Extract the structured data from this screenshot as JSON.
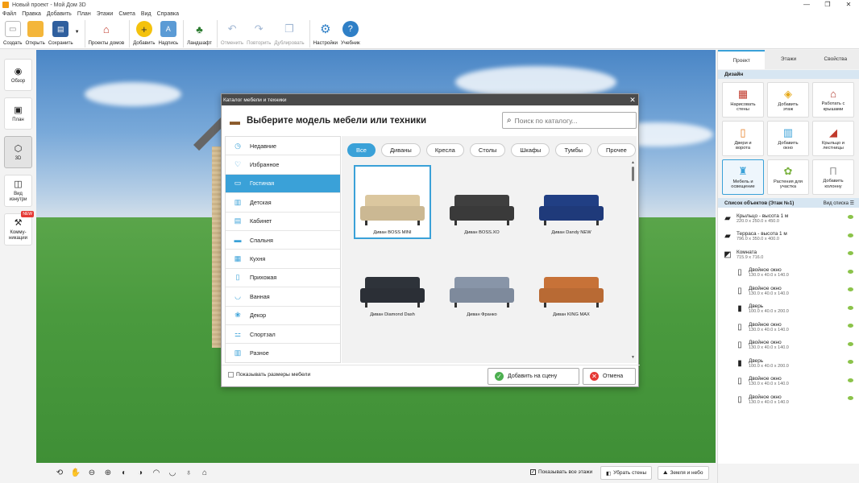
{
  "window": {
    "title": "Новый проект - Мой Дом 3D",
    "minimize": "—",
    "maximize": "❐",
    "close": "✕"
  },
  "menu": [
    "Файл",
    "Правка",
    "Добавить",
    "План",
    "Этажи",
    "Смета",
    "Вид",
    "Справка"
  ],
  "toolbar": [
    {
      "label": "Создать",
      "icon": "new-file-icon"
    },
    {
      "label": "Открыть",
      "icon": "folder-icon"
    },
    {
      "label": "Сохранить",
      "icon": "save-icon"
    },
    {
      "label": "Проекты домов",
      "icon": "house-icon"
    },
    {
      "label": "Добавить",
      "icon": "add-icon"
    },
    {
      "label": "Надпись",
      "icon": "label-icon"
    },
    {
      "label": "Ландшафт",
      "icon": "tree-icon"
    },
    {
      "label": "Отменить",
      "icon": "undo-icon"
    },
    {
      "label": "Повторить",
      "icon": "redo-icon"
    },
    {
      "label": "Дублировать",
      "icon": "duplicate-icon"
    },
    {
      "label": "Настройки",
      "icon": "gear-icon"
    },
    {
      "label": "Учебник",
      "icon": "help-icon"
    }
  ],
  "leftbar": [
    {
      "label": "Обзор",
      "icon": "eye-icon"
    },
    {
      "label": "План",
      "icon": "plan-icon"
    },
    {
      "label": "3D",
      "icon": "cube-icon"
    },
    {
      "label": "Вид изнутри",
      "icon": "interior-icon"
    },
    {
      "label": "Комму- никации",
      "icon": "communications-icon",
      "badge": "NEW"
    }
  ],
  "bottom": {
    "show_all_floors": "Показывать все этажи",
    "remove_walls": "Убрать стены",
    "earth_sky": "Земля и небо"
  },
  "rightpanel": {
    "tabs": [
      "Проект",
      "Этажи",
      "Свойства"
    ],
    "design_title": "Дизайн",
    "design_buttons": [
      {
        "label": "Нарисовать стены",
        "icon": "brick-wall-icon"
      },
      {
        "label": "Добавить этаж",
        "icon": "add-floor-icon"
      },
      {
        "label": "Работать с крышами",
        "icon": "roof-icon"
      },
      {
        "label": "Двери и ворота",
        "icon": "door-icon"
      },
      {
        "label": "Добавить окно",
        "icon": "window-icon"
      },
      {
        "label": "Крыльцо и лестницы",
        "icon": "stairs-icon"
      },
      {
        "label": "Мебель и освещение",
        "icon": "chair-icon"
      },
      {
        "label": "Растения для участка",
        "icon": "plant-icon"
      },
      {
        "label": "Добавить колонну",
        "icon": "column-icon"
      }
    ],
    "list_title": "Список объектов (Этаж №1)",
    "list_view": "Вид списка",
    "objects": [
      {
        "name": "Крыльцо - высота 1 м",
        "dims": "220.0 x 250.0 x 450.0",
        "sub": false,
        "icon": "porch-icon"
      },
      {
        "name": "Терраса - высота 1 м",
        "dims": "796.0 x 350.0 x 400.0",
        "sub": false,
        "icon": "terrace-icon"
      },
      {
        "name": "Комната",
        "dims": "715.9 x 716.0",
        "sub": false,
        "icon": "room-icon"
      },
      {
        "name": "Двойное окно",
        "dims": "130.0 x 40.0 x 140.0",
        "sub": true,
        "icon": "window-icon"
      },
      {
        "name": "Двойное окно",
        "dims": "130.0 x 40.0 x 140.0",
        "sub": true,
        "icon": "window-icon"
      },
      {
        "name": "Дверь",
        "dims": "100.0 x 40.0 x 200.0",
        "sub": true,
        "icon": "door-icon"
      },
      {
        "name": "Двойное окно",
        "dims": "130.0 x 40.0 x 140.0",
        "sub": true,
        "icon": "window-icon"
      },
      {
        "name": "Двойное окно",
        "dims": "130.0 x 40.0 x 140.0",
        "sub": true,
        "icon": "window-icon"
      },
      {
        "name": "Дверь",
        "dims": "100.0 x 40.0 x 200.0",
        "sub": true,
        "icon": "door-icon"
      },
      {
        "name": "Двойное окно",
        "dims": "130.0 x 40.0 x 140.0",
        "sub": true,
        "icon": "window-icon"
      },
      {
        "name": "Двойное окно",
        "dims": "130.0 x 40.0 x 140.0",
        "sub": true,
        "icon": "window-icon"
      }
    ]
  },
  "dialog": {
    "window_title": "Каталог мебели и техники",
    "heading": "Выберите модель мебели или техники",
    "search_placeholder": "Поиск по каталогу...",
    "categories": [
      {
        "label": "Недавние",
        "icon": "clock-icon"
      },
      {
        "label": "Избранное",
        "icon": "heart-icon"
      },
      {
        "label": "Гостиная",
        "icon": "sofa-icon",
        "active": true
      },
      {
        "label": "Детская",
        "icon": "crib-icon"
      },
      {
        "label": "Кабинет",
        "icon": "desk-icon"
      },
      {
        "label": "Спальня",
        "icon": "bed-icon"
      },
      {
        "label": "Кухня",
        "icon": "kitchen-icon"
      },
      {
        "label": "Прихожая",
        "icon": "hallway-icon"
      },
      {
        "label": "Ванная",
        "icon": "bathtub-icon"
      },
      {
        "label": "Декор",
        "icon": "decor-icon"
      },
      {
        "label": "Спортзал",
        "icon": "dumbbell-icon"
      },
      {
        "label": "Разное",
        "icon": "misc-icon"
      }
    ],
    "filters": [
      "Все",
      "Диваны",
      "Кресла",
      "Столы",
      "Шкафы",
      "Тумбы",
      "Прочее"
    ],
    "items": [
      {
        "label": "Диван BOSS MINI",
        "color": "#cbb893",
        "selected": true
      },
      {
        "label": "Диван BOSS.XO",
        "color": "#3a3a3a"
      },
      {
        "label": "Диван Dandy NEW",
        "color": "#1f3a7a"
      },
      {
        "label": "Диван Diamond Dash",
        "color": "#2b2f36"
      },
      {
        "label": "Диван Франко",
        "color": "#7e8a9c"
      },
      {
        "label": "Диван KING MAX",
        "color": "#b86a34"
      },
      {
        "label": "",
        "color": "#3b3b3b"
      },
      {
        "label": "",
        "color": "#7fb3b3"
      },
      {
        "label": "",
        "color": "#d0206e"
      }
    ],
    "show_sizes": "Показывать размеры мебели",
    "add_button": "Добавить на сцену",
    "cancel_button": "Отмена"
  },
  "colors": {
    "accent": "#3aa1d8",
    "ok": "#4caf50",
    "cancel": "#e53935"
  }
}
